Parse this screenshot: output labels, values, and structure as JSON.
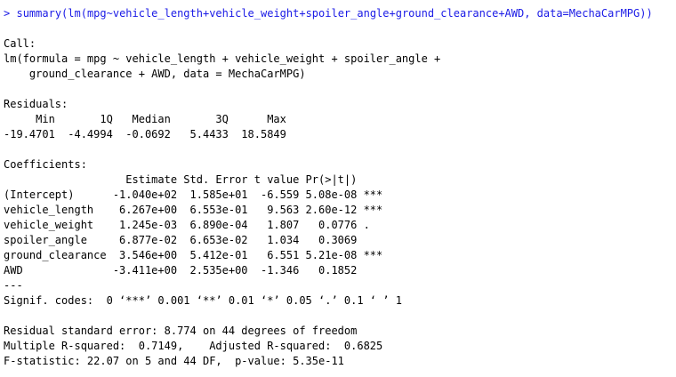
{
  "command": {
    "prompt": ">",
    "text": "summary(lm(mpg~vehicle_length+vehicle_weight+spoiler_angle+ground_clearance+AWD, data=MechaCarMPG))",
    "color": "#1a1ae6"
  },
  "call": {
    "header": "Call:",
    "line1": "lm(formula = mpg ~ vehicle_length + vehicle_weight + spoiler_angle + ",
    "line2": "    ground_clearance + AWD, data = MechaCarMPG)"
  },
  "residuals": {
    "header": "Residuals:",
    "labels": "     Min       1Q   Median       3Q      Max ",
    "values": "-19.4701  -4.4994  -0.0692   5.4433  18.5849 "
  },
  "coefficients": {
    "header": "Coefficients:",
    "columns": "                   Estimate Std. Error t value Pr(>|t|)    ",
    "rows": [
      "(Intercept)      -1.040e+02  1.585e+01  -6.559 5.08e-08 ***",
      "vehicle_length    6.267e+00  6.553e-01   9.563 2.60e-12 ***",
      "vehicle_weight    1.245e-03  6.890e-04   1.807   0.0776 .  ",
      "spoiler_angle     6.877e-02  6.653e-02   1.034   0.3069    ",
      "ground_clearance  3.546e+00  5.412e-01   6.551 5.21e-08 ***",
      "AWD              -3.411e+00  2.535e+00  -1.346   0.1852    "
    ],
    "separator": "---",
    "signif": "Signif. codes:  0 ‘***’ 0.001 ‘**’ 0.01 ‘*’ 0.05 ‘.’ 0.1 ‘ ’ 1"
  },
  "summary": {
    "rse": "Residual standard error: 8.774 on 44 degrees of freedom",
    "r2": "Multiple R-squared:  0.7149,\tAdjusted R-squared:  0.6825 ",
    "fstat": "F-statistic: 22.07 on 5 and 44 DF,  p-value: 5.35e-11"
  }
}
